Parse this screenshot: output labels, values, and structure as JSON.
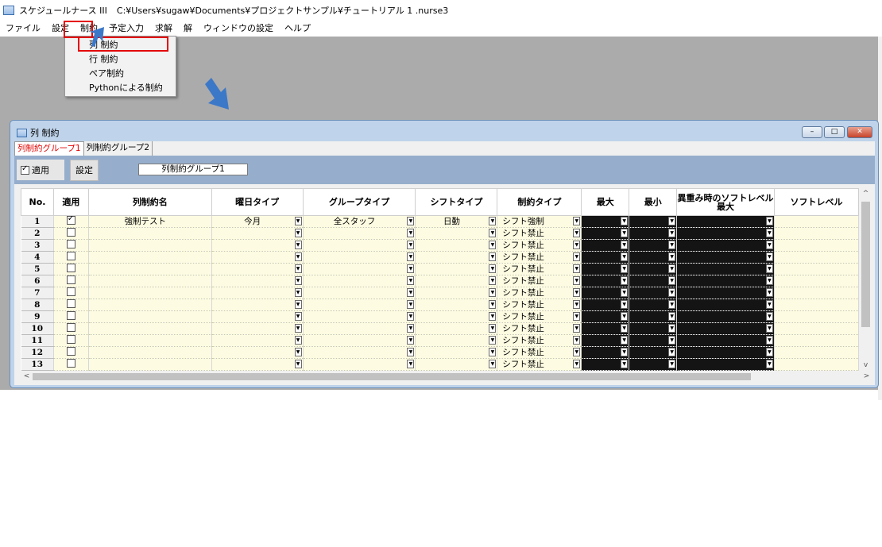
{
  "app": {
    "title": "スケジュールナース III",
    "path": "C:¥Users¥sugaw¥Documents¥プロジェクトサンプル¥チュートリアル 1 .nurse3"
  },
  "menu": [
    "ファイル",
    "設定",
    "制約",
    "予定入力",
    "求解",
    "解",
    "ウィンドウの設定",
    "ヘルプ"
  ],
  "dropdown": [
    "列 制約",
    "行 制約",
    "ペア制約",
    "Pythonによる制約"
  ],
  "window": {
    "title": "列 制約",
    "tabs": [
      "列制約グループ1",
      "列制約グループ2"
    ],
    "apply_label": "適用",
    "set_label": "設定",
    "group_name": "列制約グループ1",
    "buttons": {
      "minimize": "–",
      "maximize": "□",
      "close": "✕"
    }
  },
  "grid": {
    "columns": [
      "No.",
      "適用",
      "列制約名",
      "曜日タイプ",
      "グループタイプ",
      "シフトタイプ",
      "制約タイプ",
      "最大",
      "最小",
      "異重み時のソフトレベル最大",
      "ソフトレベル"
    ],
    "rows": [
      {
        "no": "1",
        "checked": true,
        "name": "強制テスト",
        "day_type": "今月",
        "group_type": "全スタッフ",
        "shift_type": "日勤",
        "constraint_type": "シフト強制"
      },
      {
        "no": "2",
        "checked": false,
        "name": "",
        "day_type": "",
        "group_type": "",
        "shift_type": "",
        "constraint_type": "シフト禁止"
      },
      {
        "no": "3",
        "checked": false,
        "name": "",
        "day_type": "",
        "group_type": "",
        "shift_type": "",
        "constraint_type": "シフト禁止"
      },
      {
        "no": "4",
        "checked": false,
        "name": "",
        "day_type": "",
        "group_type": "",
        "shift_type": "",
        "constraint_type": "シフト禁止"
      },
      {
        "no": "5",
        "checked": false,
        "name": "",
        "day_type": "",
        "group_type": "",
        "shift_type": "",
        "constraint_type": "シフト禁止"
      },
      {
        "no": "6",
        "checked": false,
        "name": "",
        "day_type": "",
        "group_type": "",
        "shift_type": "",
        "constraint_type": "シフト禁止"
      },
      {
        "no": "7",
        "checked": false,
        "name": "",
        "day_type": "",
        "group_type": "",
        "shift_type": "",
        "constraint_type": "シフト禁止"
      },
      {
        "no": "8",
        "checked": false,
        "name": "",
        "day_type": "",
        "group_type": "",
        "shift_type": "",
        "constraint_type": "シフト禁止"
      },
      {
        "no": "9",
        "checked": false,
        "name": "",
        "day_type": "",
        "group_type": "",
        "shift_type": "",
        "constraint_type": "シフト禁止"
      },
      {
        "no": "10",
        "checked": false,
        "name": "",
        "day_type": "",
        "group_type": "",
        "shift_type": "",
        "constraint_type": "シフト禁止"
      },
      {
        "no": "11",
        "checked": false,
        "name": "",
        "day_type": "",
        "group_type": "",
        "shift_type": "",
        "constraint_type": "シフト禁止"
      },
      {
        "no": "12",
        "checked": false,
        "name": "",
        "day_type": "",
        "group_type": "",
        "shift_type": "",
        "constraint_type": "シフト禁止"
      },
      {
        "no": "13",
        "checked": false,
        "name": "",
        "day_type": "",
        "group_type": "",
        "shift_type": "",
        "constraint_type": "シフト禁止"
      }
    ]
  },
  "colors": {
    "highlight": "#e30000",
    "arrow": "#3c78c8",
    "workspace": "#ababab",
    "window_frame": "#bfd3ea",
    "toolbar": "#96aecb",
    "row_bg": "#fdfbe1"
  }
}
